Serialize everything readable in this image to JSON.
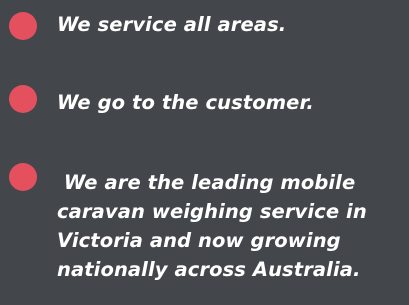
{
  "features": {
    "items": [
      {
        "text": "We service all areas."
      },
      {
        "text": "We go to the customer."
      },
      {
        "lines": [
          " We are the leading mobile",
          "caravan weighing service in",
          "Victoria and now growing",
          "nationally across Australia."
        ]
      }
    ]
  },
  "colors": {
    "background": "#43474c",
    "bullet": "#e5505e",
    "text": "#ffffff"
  }
}
